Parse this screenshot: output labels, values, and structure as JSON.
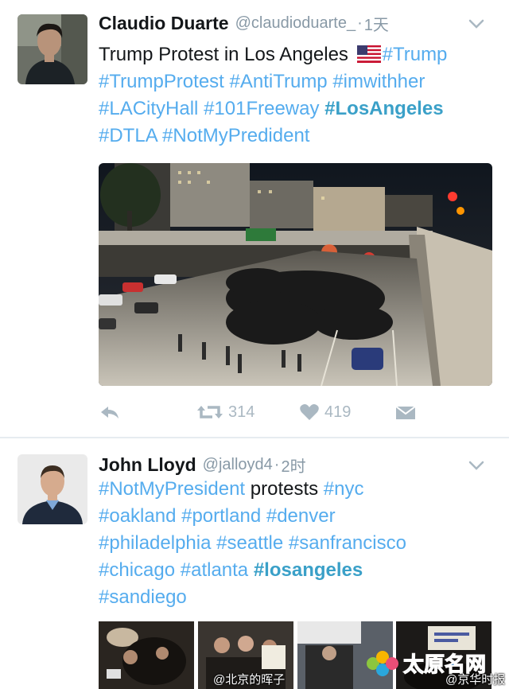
{
  "tweets": [
    {
      "name": "Claudio Duarte",
      "handle": "@claudioduarte_",
      "dot": "·",
      "time": "1天",
      "avatar_icon": "user-avatar-man-dark-shirt",
      "text_lines": [
        [
          "Trump Protest in Los Angeles",
          "#Trump"
        ],
        [
          "#TrumpProtest",
          "#AntiTrump",
          "#imwithher"
        ],
        [
          "#LACityHall",
          "#101Freeway",
          "#LosAngeles"
        ],
        [
          "#DTLA",
          "#NotMyPredident"
        ]
      ],
      "photo_alt_icon": "protest-freeway-night-photo",
      "actions": {
        "reply_icon": "reply-icon",
        "retweet_icon": "retweet-icon",
        "retweet_count": "314",
        "like_icon": "heart-icon",
        "like_count": "419",
        "dm_icon": "envelope-icon"
      }
    },
    {
      "name": "John Lloyd",
      "handle": "@jalloyd4",
      "dot": "·",
      "time": "2时",
      "avatar_icon": "user-avatar-man-suit",
      "text_lines": [
        [
          "#NotMyPresident",
          "protests",
          "#nyc"
        ],
        [
          "#oakland",
          "#portland",
          "#denver"
        ],
        [
          "#philadelphia",
          "#seattle",
          "#sanfrancisco"
        ],
        [
          "#chicago",
          "#atlanta",
          "#losangeles"
        ],
        [
          "#sandiego"
        ]
      ],
      "photo_strip_icon": "protest-photo-strip"
    }
  ],
  "watermarks": {
    "left": "@北京的晖子",
    "right": "@京华时报",
    "logo_text": "太原名网"
  },
  "colors": {
    "link": "#55acee",
    "muted": "#8899a6",
    "action": "#aab8c2",
    "divider": "#e6ecf0"
  }
}
